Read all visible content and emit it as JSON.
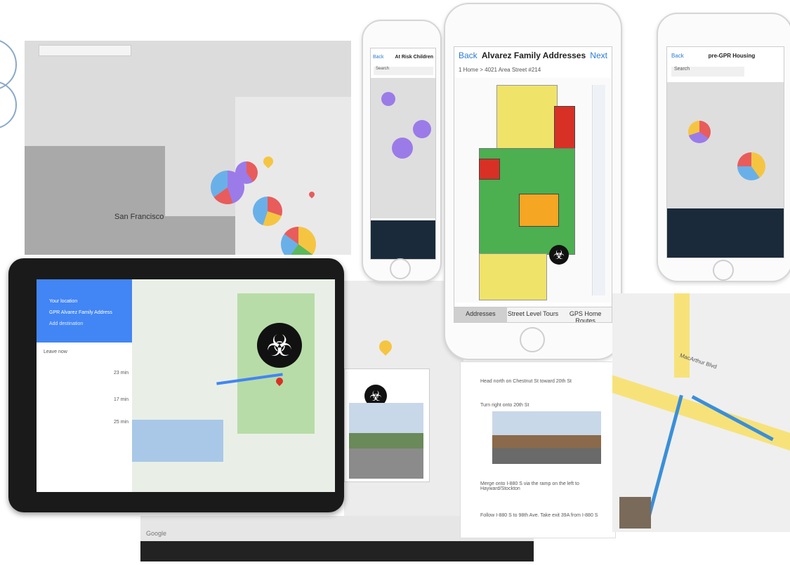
{
  "background_map": {
    "city_label": "San Francisco",
    "google_label": "Google"
  },
  "phone_left": {
    "back_label": "Back",
    "title": "At Risk Children",
    "search_placeholder": "Search"
  },
  "phone_center": {
    "back_label": "Back",
    "title": "Alvarez Family Addresses",
    "next_label": "Next",
    "breadcrumb": "1 Home > 4021 Area Street #214",
    "tabs": [
      "Addresses",
      "Street Level Tours",
      "GPS Home Routes"
    ]
  },
  "phone_right": {
    "back_label": "Back",
    "title": "pre-GPR Housing",
    "search_placeholder": "Search"
  },
  "tablet": {
    "directions_items": [
      "Your location",
      "GPR Alvarez Family Address",
      "Add destination"
    ],
    "summary": "Leave now",
    "routes": [
      "23 min",
      "17 min",
      "25 min"
    ]
  },
  "directions_panel": {
    "steps": [
      "Head north on Chestnut St toward 20th St",
      "Turn right onto 20th St",
      "Merge onto I-880 S via the ramp on the left to Hayward/Stockton",
      "Follow I-880 S to 98th Ave. Take exit 39A from I-880 S"
    ]
  },
  "street_map": {
    "street_name": "MacArthur Blvd"
  },
  "colors": {
    "safe_green": "#4caf50",
    "caution_yellow": "#f0e36a",
    "warning_orange": "#f5a623",
    "danger_red": "#d93025",
    "route_blue": "#3a8fd8",
    "google_blue": "#4285f4"
  },
  "icons": [
    "biohazard-icon",
    "location-pin-icon",
    "search-icon"
  ]
}
